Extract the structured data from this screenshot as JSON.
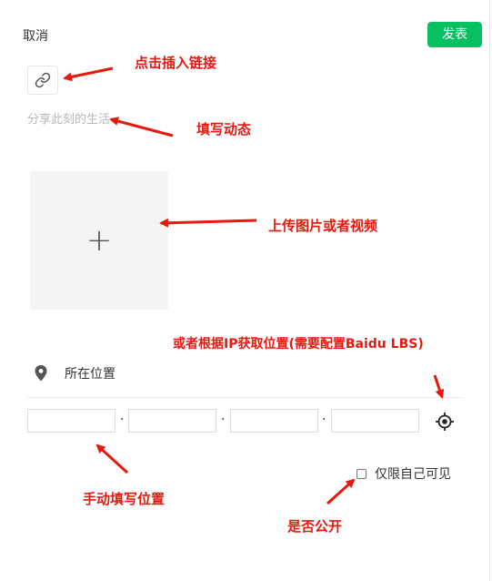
{
  "header": {
    "cancel_label": "取消",
    "publish_label": "发表",
    "publish_color": "#07c160"
  },
  "toolbar": {
    "link_icon": "link-icon"
  },
  "editor": {
    "placeholder": "分享此刻的生活"
  },
  "upload": {
    "icon": "plus-icon"
  },
  "location": {
    "label": "所在位置",
    "icon": "map-pin-icon",
    "coordinates": [
      "",
      "",
      "",
      ""
    ],
    "separators": [
      "·",
      "·",
      "·"
    ],
    "locate_icon": "crosshair-locate-icon"
  },
  "visibility": {
    "label": "仅限自己可见",
    "checked": false
  },
  "annotations": {
    "link": "点击插入链接",
    "compose": "填写动态",
    "upload": "上传图片或者视频",
    "ip_location": "或者根据IP获取位置(需要配置Baidu LBS)",
    "manual_location": "手动填写位置",
    "public": "是否公开",
    "color": "#e8180e"
  }
}
